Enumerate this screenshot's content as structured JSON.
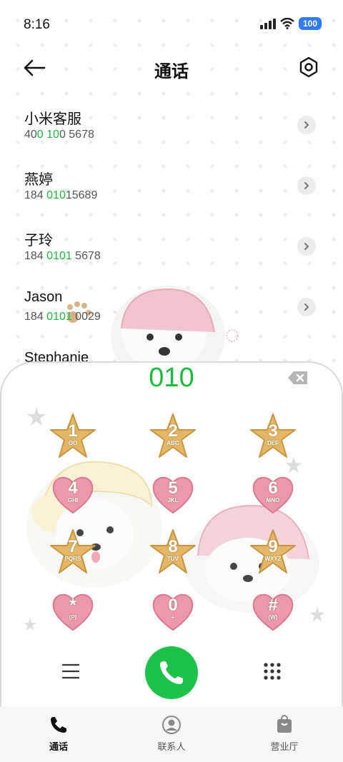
{
  "status_bar": {
    "time": "8:16",
    "battery": "100"
  },
  "header": {
    "title": "通话"
  },
  "contacts": [
    {
      "name": "小米客服",
      "number_parts": [
        "40",
        "0 10",
        "0 5678"
      ]
    },
    {
      "name": "燕婷",
      "number_parts": [
        "184 ",
        "010",
        "15689"
      ]
    },
    {
      "name": "子玲",
      "number_parts": [
        "184 ",
        "0101",
        " 5678"
      ]
    },
    {
      "name": "Jason",
      "number_parts": [
        "184 ",
        "0101",
        " 0029"
      ]
    },
    {
      "name": "Stephanie",
      "number_parts": [
        "",
        "",
        ""
      ]
    }
  ],
  "dialer": {
    "input": "010",
    "keys": [
      {
        "digit": "1",
        "letters": "OO"
      },
      {
        "digit": "2",
        "letters": "ABC"
      },
      {
        "digit": "3",
        "letters": "DEF"
      },
      {
        "digit": "4",
        "letters": "GHI"
      },
      {
        "digit": "5",
        "letters": "JKL"
      },
      {
        "digit": "6",
        "letters": "MNO"
      },
      {
        "digit": "7",
        "letters": "PQRS"
      },
      {
        "digit": "8",
        "letters": "TUV"
      },
      {
        "digit": "9",
        "letters": "WXYZ"
      },
      {
        "digit": "*",
        "letters": "(P)"
      },
      {
        "digit": "0",
        "letters": "+"
      },
      {
        "digit": "#",
        "letters": "(W)"
      }
    ]
  },
  "tabs": [
    {
      "label": "通话",
      "icon": "phone-icon"
    },
    {
      "label": "联系人",
      "icon": "contacts-icon"
    },
    {
      "label": "营业厅",
      "icon": "shop-bag-icon"
    }
  ],
  "colors": {
    "accent": "#1db93d",
    "call": "#1dc24a",
    "battery": "#2f7bf5"
  }
}
